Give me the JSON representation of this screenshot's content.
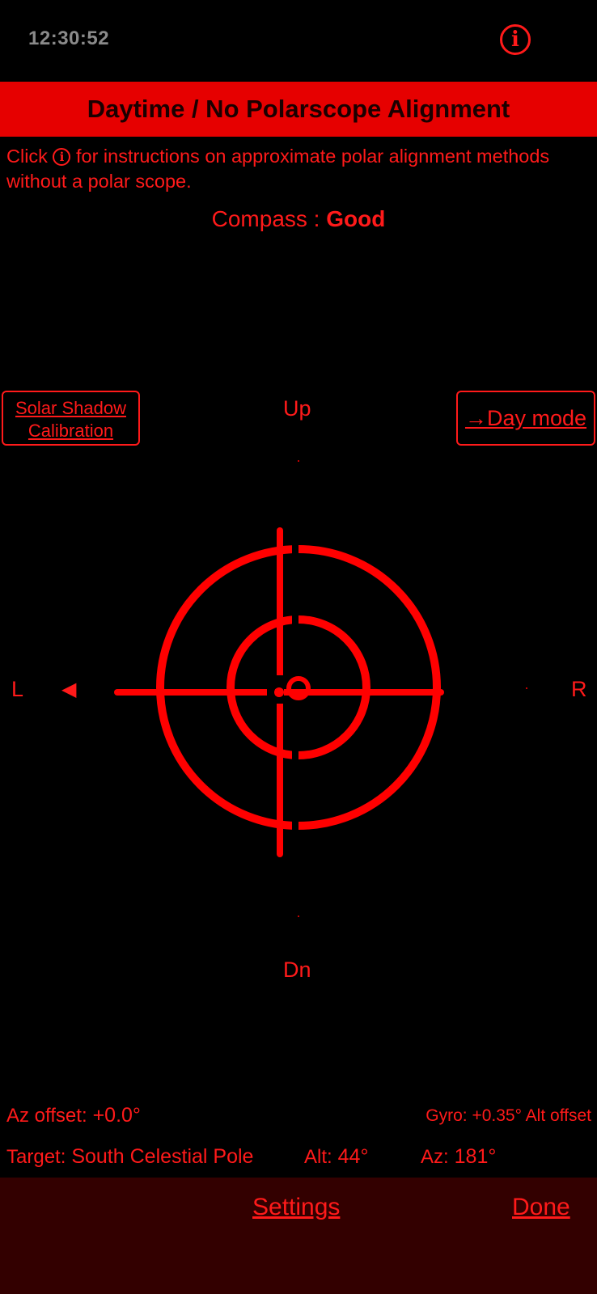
{
  "status_bar": {
    "time": "12:30:52"
  },
  "info_icon": "i",
  "title": "Daytime / No Polarscope Alignment",
  "instructions": {
    "before": "Click",
    "icon": "i",
    "after": " for instructions on approximate polar alignment methods without a polar scope."
  },
  "compass": {
    "label": "Compass : ",
    "value": "Good"
  },
  "buttons": {
    "solar_line1": "Solar Shadow",
    "solar_line2": "Calibration",
    "day_mode": "→Day mode"
  },
  "directions": {
    "up": "Up",
    "down": "Dn",
    "left": "L",
    "right": "R",
    "left_arrow": "◀"
  },
  "readouts": {
    "az_offset_label": "Az offset:",
    "az_offset_value": "+0.0°",
    "gyro_label": "Gyro:",
    "gyro_value": "+0.35°",
    "alt_offset_label": "Alt offset",
    "target_label": "Target:",
    "target_value": "South Celestial Pole",
    "alt_label": "Alt:",
    "alt_value": "44°",
    "az_label": "Az:",
    "az_value": "181°"
  },
  "footer": {
    "settings": "Settings",
    "done": "Done"
  },
  "colors": {
    "accent": "#ff1a1a",
    "title_bg": "#e60000",
    "footer_bg": "#330000",
    "clock": "#8a8a8a"
  }
}
